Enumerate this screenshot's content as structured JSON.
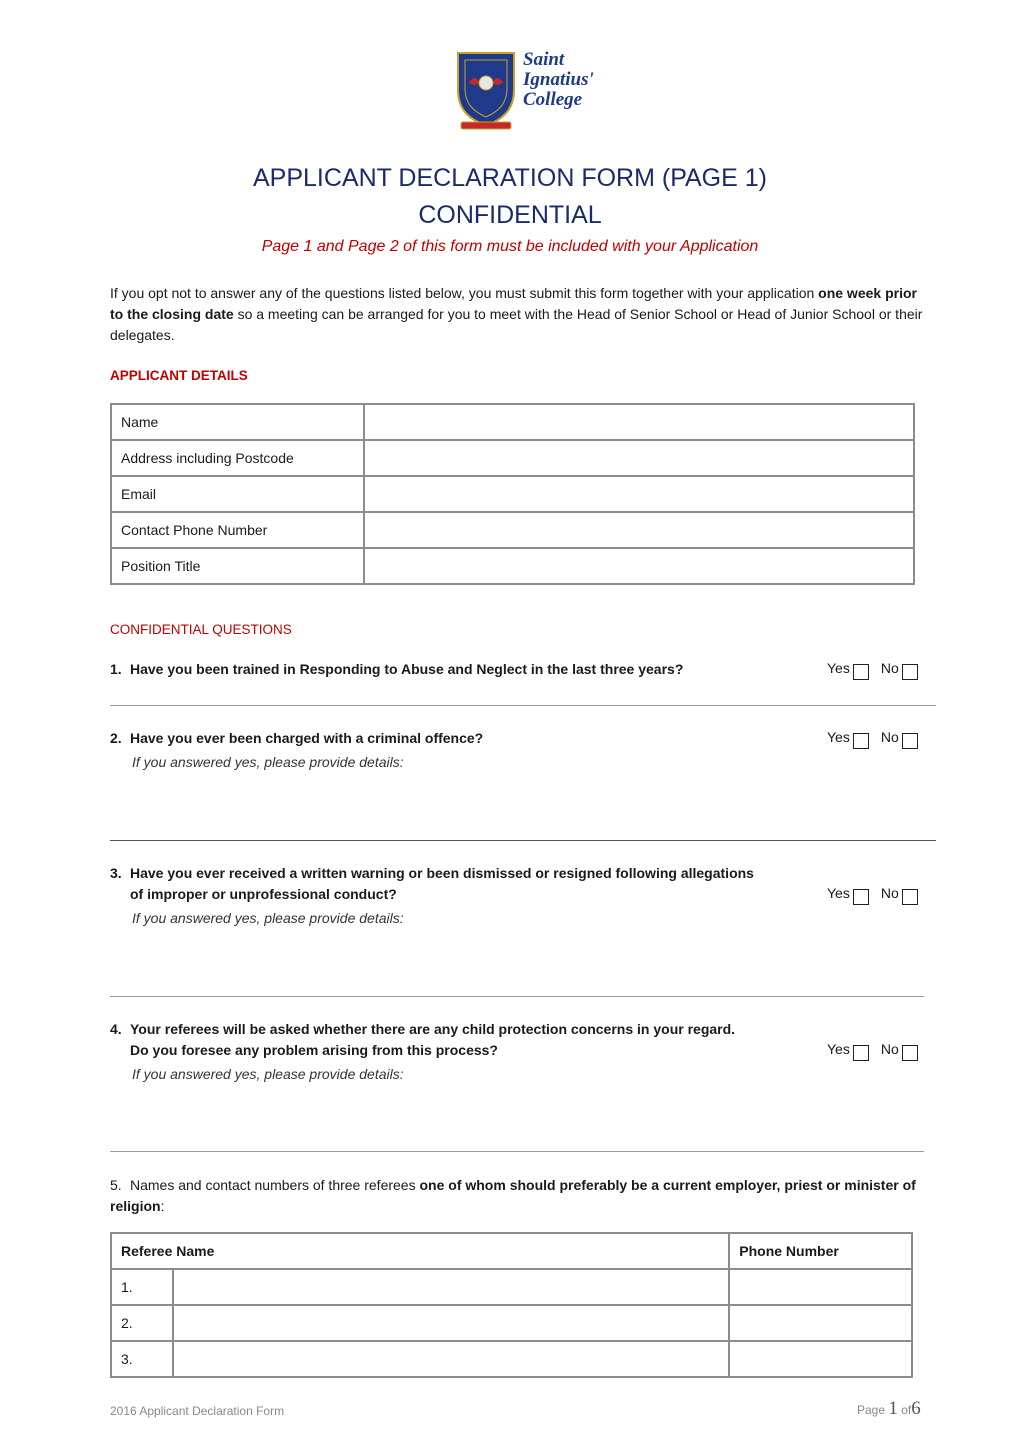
{
  "header": {
    "logo_name": [
      "Saint",
      "Ignatius'",
      "College"
    ],
    "title": "APPLICANT DECLARATION FORM (PAGE 1)",
    "subtitle": "CONFIDENTIAL",
    "notice": "Page 1 and Page 2 of this form must be included with your Application"
  },
  "intro": {
    "part1": "If you opt not to answer any of the questions listed below, you must submit this form together with your application ",
    "bold": "one week prior to the closing date",
    "part2": " so a meeting can be arranged for you to meet with the Head of Senior School or Head of Junior School or their delegates."
  },
  "applicant_details": {
    "heading": "APPLICANT DETAILS",
    "fields": [
      {
        "label": "Name",
        "value": ""
      },
      {
        "label": "Address including Postcode",
        "value": ""
      },
      {
        "label": "Email",
        "value": ""
      },
      {
        "label": "Contact Phone Number",
        "value": ""
      },
      {
        "label": "Position Title",
        "value": ""
      }
    ]
  },
  "confidential": {
    "heading": "CONFIDENTIAL QUESTIONS",
    "yes_label": "Yes",
    "no_label": "No",
    "details_hint": "If you answered yes, please provide details:",
    "questions": [
      {
        "num": "1.",
        "line1": "Have you been trained in Responding to Abuse and Neglect in the last three years?",
        "line2": ""
      },
      {
        "num": "2.",
        "line1": "Have you ever been charged with a criminal offence?",
        "line2": ""
      },
      {
        "num": "3.",
        "line1": "Have you ever received a written warning or been dismissed or resigned following allegations",
        "line2": "of improper or unprofessional conduct?"
      },
      {
        "num": "4.",
        "line1": "Your referees will be asked whether there are any child protection concerns in your regard.",
        "line2": "Do you foresee any problem arising from this process?"
      }
    ],
    "q5": {
      "num": "5.",
      "text": "Names and contact numbers of three referees ",
      "bold": "one of whom should preferably be a current employer, priest or minister of religion",
      "tail": ":"
    }
  },
  "referees": {
    "headers": [
      "Referee Name",
      "Phone Number"
    ],
    "rows": [
      {
        "num": "1.",
        "name": "",
        "phone": ""
      },
      {
        "num": "2.",
        "name": "",
        "phone": ""
      },
      {
        "num": "3.",
        "name": "",
        "phone": ""
      }
    ]
  },
  "footer": {
    "left": "2016 Applicant Declaration Form",
    "page_word": "Page",
    "page_num": "1",
    "of_word": "of",
    "page_total": "6"
  }
}
